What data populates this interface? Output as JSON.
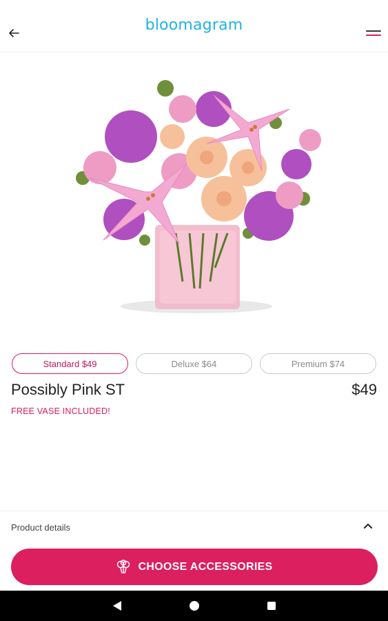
{
  "header": {
    "logo": "bloomagram",
    "back_icon": "arrow-left-icon",
    "menu_icon": "hamburger-menu-icon"
  },
  "product": {
    "image_alt": "Pink lily and rose bouquet in pink glass vase",
    "name": "Possibly Pink ST",
    "price": "$49",
    "promo": "FREE VASE INCLUDED!"
  },
  "options": [
    {
      "label": "Standard $49",
      "selected": true
    },
    {
      "label": "Deluxe $64",
      "selected": false
    },
    {
      "label": "Premium $74",
      "selected": false
    }
  ],
  "details": {
    "label": "Product details",
    "icon": "chevron-up-icon"
  },
  "cta": {
    "label": "CHOOSE ACCESSORIES",
    "icon": "balloons-icon"
  },
  "nav": {
    "back": "nav-back-icon",
    "home": "nav-home-icon",
    "recents": "nav-recents-icon"
  },
  "colors": {
    "brand": "#1fb2e6",
    "accent": "#dc1f5f",
    "promo": "#d81b60"
  }
}
